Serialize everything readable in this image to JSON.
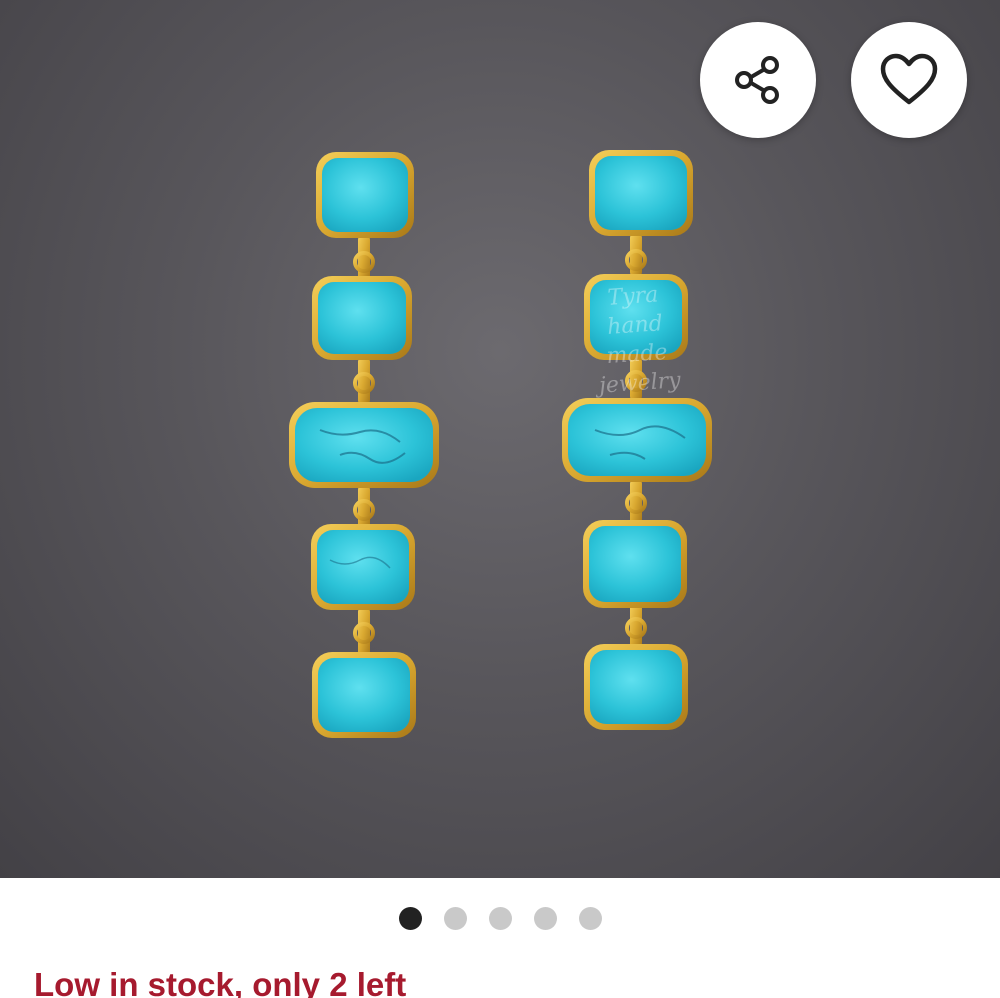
{
  "product": {
    "image_alt": "Turquoise gold bezel drop earrings",
    "watermark": [
      "Tyra",
      "hand",
      "made",
      "jewelry"
    ],
    "stone_color": "#2fc3d6",
    "gold_color": "#d9a830"
  },
  "actions": {
    "share_icon": "share-icon",
    "favorite_icon": "heart-icon"
  },
  "carousel": {
    "total": 5,
    "active_index": 0
  },
  "stock": {
    "text": "Low in stock, only 2 left",
    "color": "#a61a2e"
  }
}
